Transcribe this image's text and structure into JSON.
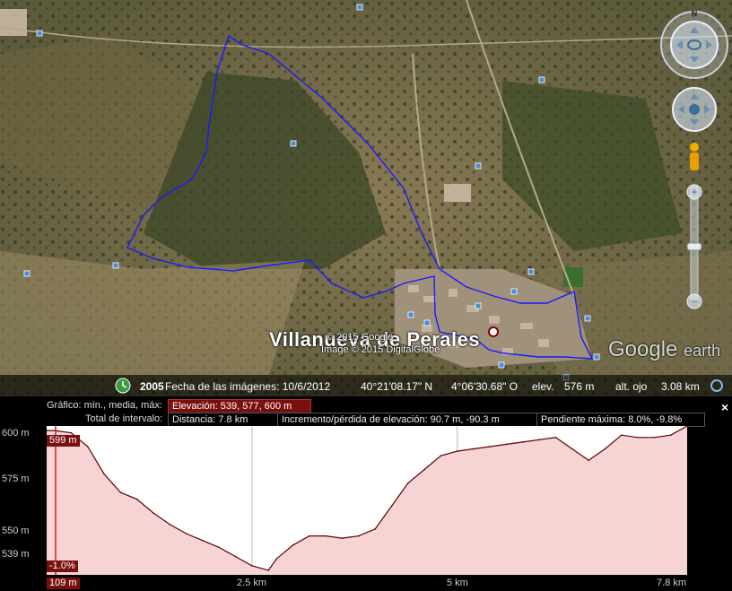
{
  "map": {
    "town_label": "Villanueva de Perales",
    "copyright_1": "© 2015 Google",
    "copyright_2": "Image © 2015 DigitalGlobe",
    "brand": "Google",
    "brand_suffix": "earth",
    "compass_north": "N",
    "colors": {
      "route": "#1a1aff",
      "profile_fill": "#f6d4d4",
      "profile_line": "#5a0000",
      "accent": "#7a0f0f"
    }
  },
  "statusbar": {
    "year": "2005",
    "imagery_date": "Fecha de las imágenes: 10/6/2012",
    "lat": "40°21'08.17\" N",
    "lon": "4°06'30.68\" O",
    "elev_label": "elev.",
    "elev_value": "576 m",
    "eye_label": "alt. ojo",
    "eye_value": "3.08 km"
  },
  "profile": {
    "graph_label": "Gráfico: mín., media, máx:",
    "elevation_box": "Elevación: 539, 577, 600 m",
    "interval_label": "Total de intervalo:",
    "distance_box": "Distancia: 7.8 km",
    "gain_box": "Incremento/pérdida de elevación: 90.7 m, -90.3 m",
    "slope_box": "Pendiente máxima: 8.0%, -9.8%",
    "y_ticks": [
      "600 m",
      "575 m",
      "550 m",
      "539 m"
    ],
    "x_ticks": [
      "2.5 km",
      "5 km",
      "7.8 km"
    ],
    "cursor_elev": "599 m",
    "cursor_slope": "-1.0%",
    "cursor_dist": "109 m",
    "close_symbol": "×"
  },
  "chart_data": {
    "type": "area",
    "xlabel": "",
    "ylabel": "",
    "xlim": [
      0,
      7.8
    ],
    "ylim": [
      536,
      601
    ],
    "x": [
      0,
      0.1,
      0.3,
      0.5,
      0.7,
      0.9,
      1.1,
      1.3,
      1.5,
      1.7,
      1.9,
      2.1,
      2.3,
      2.5,
      2.7,
      2.8,
      3.0,
      3.2,
      3.4,
      3.6,
      3.8,
      4.0,
      4.2,
      4.4,
      4.6,
      4.8,
      5.0,
      5.2,
      5.4,
      5.6,
      5.8,
      6.0,
      6.2,
      6.4,
      6.6,
      6.8,
      7.0,
      7.2,
      7.4,
      7.6,
      7.8
    ],
    "y": [
      599,
      599,
      598,
      592,
      580,
      572,
      569,
      563,
      558,
      554,
      551,
      548,
      544,
      540,
      538,
      543,
      549,
      553,
      553,
      552,
      553,
      556,
      566,
      576,
      582,
      588,
      590,
      591,
      592,
      593,
      594,
      595,
      596,
      591,
      586,
      591,
      597,
      596,
      596,
      597,
      601
    ]
  }
}
